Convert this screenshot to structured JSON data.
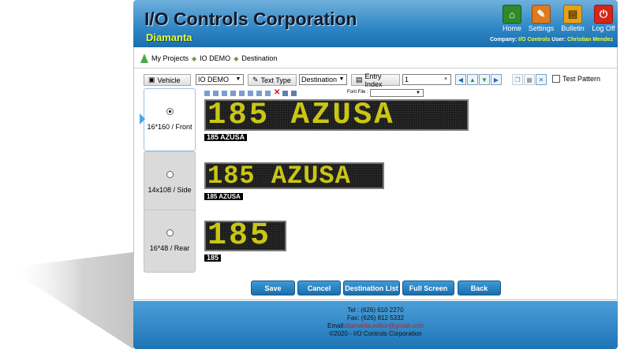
{
  "header": {
    "title": "I/O Controls Corporation",
    "subtitle": "Diamanta",
    "buttons": [
      {
        "label": "Home",
        "icon": "home-icon",
        "color": "#2f8a2a"
      },
      {
        "label": "Settings",
        "icon": "wrench-icon",
        "color": "#e07a1c"
      },
      {
        "label": "Bulletin",
        "icon": "bulletin-icon",
        "color": "#e6a21a"
      },
      {
        "label": "Log Off",
        "icon": "power-icon",
        "color": "#d6261a"
      }
    ],
    "company_label": "Company:",
    "company_value": "I/O Controls",
    "user_label": "User:",
    "user_value": "Christian Mendez"
  },
  "breadcrumb": {
    "items": [
      "My Projects",
      "IO DEMO",
      "Destination"
    ]
  },
  "toolbar": {
    "vehicle_label": "Vehicle",
    "vehicle_value": "IO DEMO",
    "text_type_label": "Text Type",
    "text_type_value": "Destination",
    "entry_index_label": "Entry Index",
    "entry_index_value": "1",
    "clear_glyph": "×",
    "test_pattern_label": "Test Pattern"
  },
  "format_bar": {
    "font_file_label": "Font File :",
    "font_file_value": ""
  },
  "signs": [
    {
      "tab_label": "16*160 / Front",
      "text": "185  AZUSA",
      "caption": "185  AZUSA",
      "selected": true
    },
    {
      "tab_label": "14x108 / Side",
      "text": "185 AZUSA",
      "caption": "185 AZUSA",
      "selected": false
    },
    {
      "tab_label": "16*48 / Rear",
      "text": "185",
      "caption": "185",
      "selected": false
    }
  ],
  "actions": {
    "save": "Save",
    "cancel": "Cancel",
    "destination_list": "Destination List",
    "full_screen": "Full Screen",
    "back": "Back"
  },
  "footer": {
    "tel": "Tel : (626) 610 2270",
    "fax": "Fax: (626) 812 5332",
    "email_label": "Email:",
    "email_value": "diamanta.editor@gmail.com",
    "copyright": "©2020 - I/O Controls Corporation"
  },
  "colors": {
    "led_text": "#c9c615",
    "header_blue": "#2e86c4",
    "subtitle_yellow": "#e6ff3a"
  }
}
